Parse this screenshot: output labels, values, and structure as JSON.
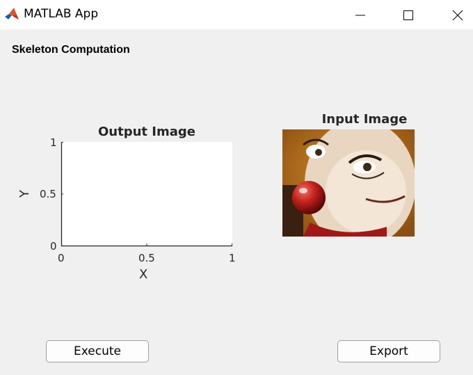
{
  "window": {
    "title": "MATLAB App"
  },
  "app": {
    "section_title": "Skeleton Computation"
  },
  "output_axes": {
    "title": "Output Image",
    "xlabel": "X",
    "ylabel": "Y",
    "xticks": [
      "0",
      "0.5",
      "1"
    ],
    "yticks": [
      "0",
      "0.5",
      "1"
    ]
  },
  "input_image": {
    "title": "Input Image"
  },
  "buttons": {
    "execute": "Execute",
    "export": "Export"
  },
  "colors": {
    "window_bg": "#f0f0f0",
    "titlebar_bg": "#ffffff",
    "axis_color": "#262626"
  },
  "icons": [
    "matlab-icon",
    "minimize-icon",
    "maximize-icon",
    "close-icon"
  ]
}
